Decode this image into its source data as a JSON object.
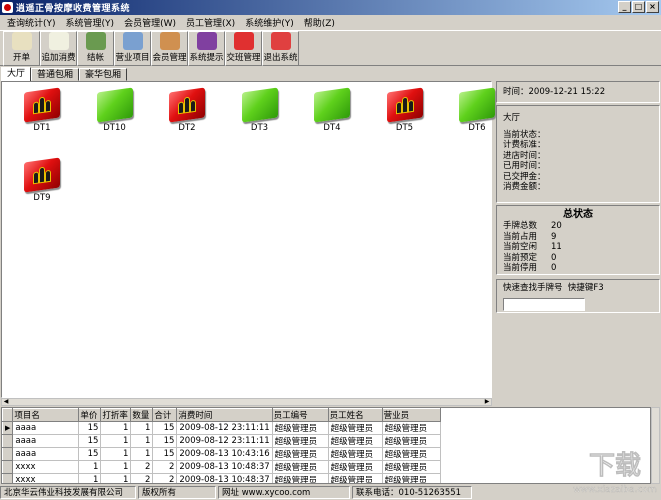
{
  "window": {
    "title": "逍遥正骨按摩收费管理系统"
  },
  "menu": [
    "查询统计(Y)",
    "系统管理(Y)",
    "会员管理(W)",
    "员工管理(X)",
    "系统维护(Y)",
    "帮助(Z)"
  ],
  "toolbar": [
    {
      "label": "开单",
      "icon": "pencil-icon",
      "color": "#e8e0c0"
    },
    {
      "label": "追加消费",
      "icon": "document-edit-icon",
      "color": "#f0f0e0"
    },
    {
      "label": "结帐",
      "icon": "money-bag-icon",
      "color": "#6a9a50"
    },
    {
      "label": "营业项目",
      "icon": "computer-icon",
      "color": "#7aa0d0"
    },
    {
      "label": "会员管理",
      "icon": "users-icon",
      "color": "#d09050"
    },
    {
      "label": "系统提示",
      "icon": "info-icon",
      "color": "#8040a0"
    },
    {
      "label": "交班管理",
      "icon": "recycle-icon",
      "color": "#e03030"
    },
    {
      "label": "退出系统",
      "icon": "no-entry-icon",
      "color": "#e04040"
    }
  ],
  "tabs": [
    "大厅",
    "普通包厢",
    "豪华包厢"
  ],
  "rooms": [
    {
      "name": "DT1",
      "status": "occupied"
    },
    {
      "name": "DT10",
      "status": "free"
    },
    {
      "name": "DT2",
      "status": "occupied"
    },
    {
      "name": "DT3",
      "status": "free"
    },
    {
      "name": "DT4",
      "status": "free"
    },
    {
      "name": "DT5",
      "status": "occupied"
    },
    {
      "name": "DT6",
      "status": "free"
    },
    {
      "name": "DT9",
      "status": "occupied"
    }
  ],
  "colors": {
    "occupied": "#e01010",
    "free": "#5fd11c",
    "chrome": "#d4d0c8"
  },
  "info": {
    "time_label": "时间：",
    "time": "2009-12-21 15:22",
    "area": "大厅",
    "fields": [
      "当前状态：",
      "计费标准：",
      "进店时间：",
      "已用时间：",
      "已交押金：",
      "消费金额："
    ]
  },
  "summary": {
    "title": "总状态",
    "rows": [
      {
        "label": "手牌总数",
        "value": "20"
      },
      {
        "label": "当前占用",
        "value": "9"
      },
      {
        "label": "当前空闲",
        "value": "11"
      },
      {
        "label": "当前预定",
        "value": "0"
      },
      {
        "label": "当前停用",
        "value": "0"
      }
    ]
  },
  "search": {
    "label": "快速查找手牌号",
    "hotkey": "快捷键F3"
  },
  "grid": {
    "columns": [
      "项目名",
      "单价",
      "打折率",
      "数量",
      "合计",
      "消费时间",
      "员工编号",
      "员工姓名",
      "营业员"
    ],
    "rows": [
      [
        "aaaa",
        "15",
        "1",
        "1",
        "15",
        "2009-08-12 23:11:11",
        "超级管理员",
        "超级管理员",
        "超级管理员"
      ],
      [
        "aaaa",
        "15",
        "1",
        "1",
        "15",
        "2009-08-12 23:11:11",
        "超级管理员",
        "超级管理员",
        "超级管理员"
      ],
      [
        "aaaa",
        "15",
        "1",
        "1",
        "15",
        "2009-08-13 10:43:16",
        "超级管理员",
        "超级管理员",
        "超级管理员"
      ],
      [
        "xxxx",
        "1",
        "1",
        "2",
        "2",
        "2009-08-13 10:48:37",
        "超级管理员",
        "超级管理员",
        "超级管理员"
      ],
      [
        "xxxx",
        "1",
        "1",
        "2",
        "2",
        "2009-08-13 10:48:37",
        "超级管理员",
        "超级管理员",
        "超级管理员"
      ]
    ]
  },
  "statusbar": [
    "北京华云伟业科技发展有限公司",
    "版权所有",
    "网址 www.xycoo.com",
    "联系电话：010-51263551"
  ]
}
